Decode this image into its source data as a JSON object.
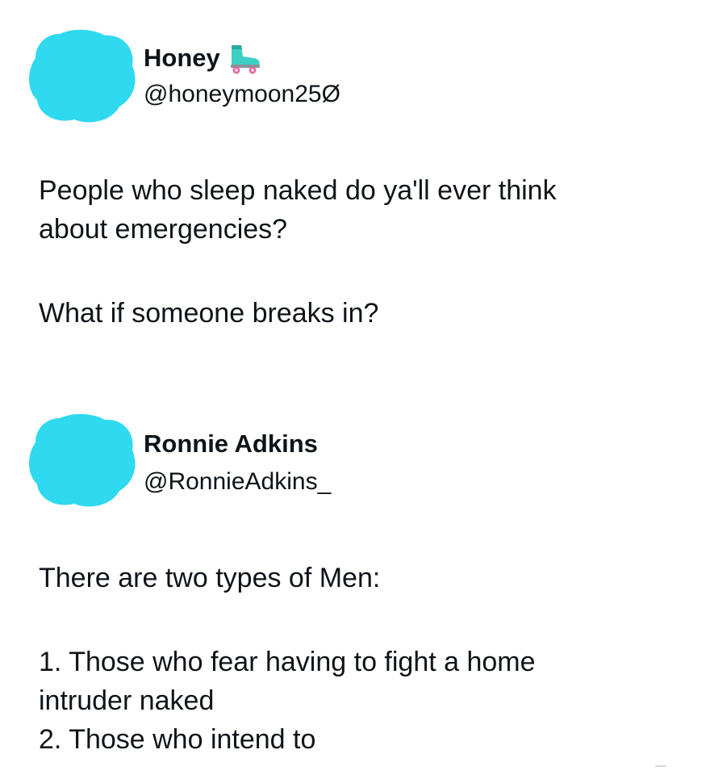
{
  "tweets": [
    {
      "display_name": "Honey",
      "emoji": "roller-skate-emoji",
      "handle": "@honeymoon25Ø",
      "avatar_color": "#2FD9F0",
      "lines": [
        "People who sleep naked do ya'll ever think",
        "about emergencies?",
        "What if someone breaks in?"
      ]
    },
    {
      "display_name": "Ronnie Adkins",
      "handle": "@RonnieAdkins_",
      "avatar_color": "#2FD9F0",
      "lines": [
        "There are two types of Men:",
        "1. Those who fear having to fight a home",
        "intruder naked",
        "2. Those who intend to"
      ]
    }
  ]
}
